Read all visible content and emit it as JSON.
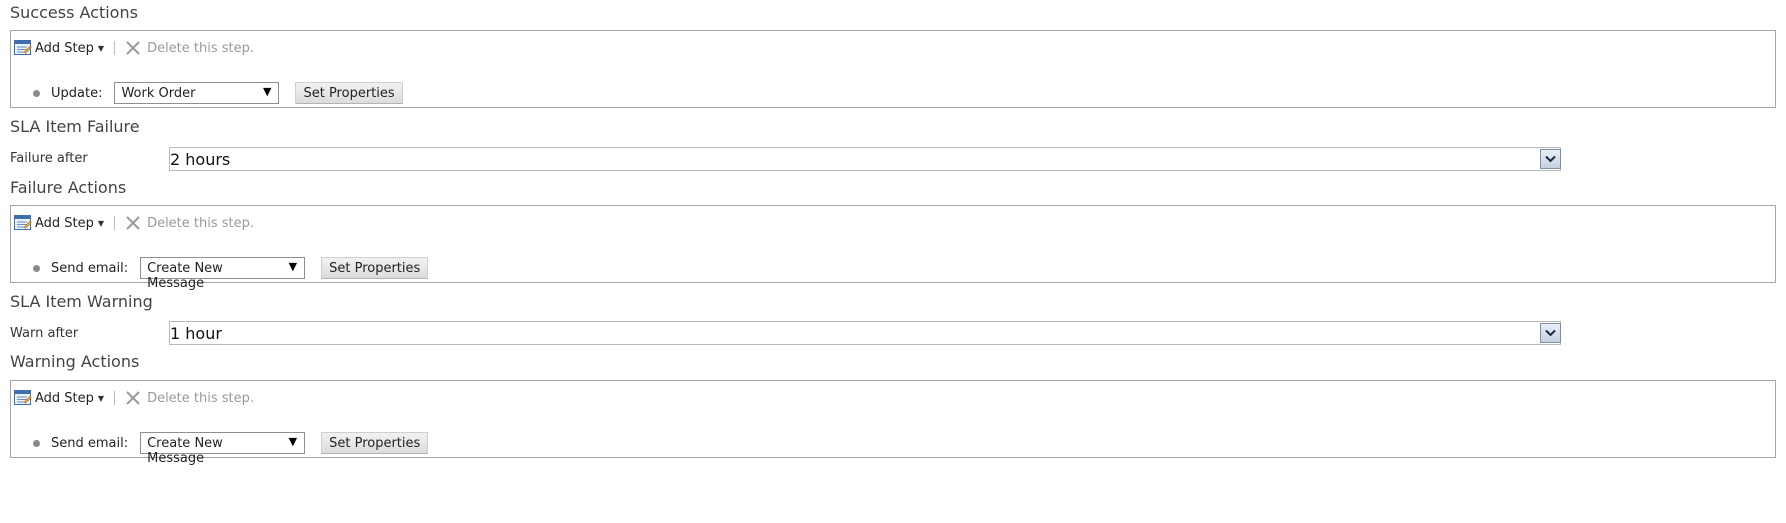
{
  "success": {
    "title": "Success Actions",
    "toolbar": {
      "add_step": "Add Step",
      "delete_step": "Delete this step."
    },
    "step": {
      "label": "Update:",
      "select_value": "Work Order",
      "button": "Set Properties"
    }
  },
  "failure": {
    "title": "SLA Item Failure",
    "field_label": "Failure after",
    "field_value": "2 hours",
    "actions_title": "Failure Actions",
    "toolbar": {
      "add_step": "Add Step",
      "delete_step": "Delete this step."
    },
    "step": {
      "label": "Send email:",
      "select_value": "Create New Message",
      "button": "Set Properties"
    }
  },
  "warning": {
    "title": "SLA Item Warning",
    "field_label": "Warn after",
    "field_value": "1 hour",
    "actions_title": "Warning Actions",
    "toolbar": {
      "add_step": "Add Step",
      "delete_step": "Delete this step."
    },
    "step": {
      "label": "Send email:",
      "select_value": "Create New Message",
      "button": "Set Properties"
    }
  },
  "icons": {
    "add_step": "add-step-icon",
    "delete": "x-icon",
    "select_arrow": "down-triangle",
    "dropdown": "chevron-down-icon"
  },
  "colors": {
    "box_border": "#a6a6a6",
    "dropdown_button": "#c6d1df",
    "disabled_text": "#9a9a9a"
  }
}
